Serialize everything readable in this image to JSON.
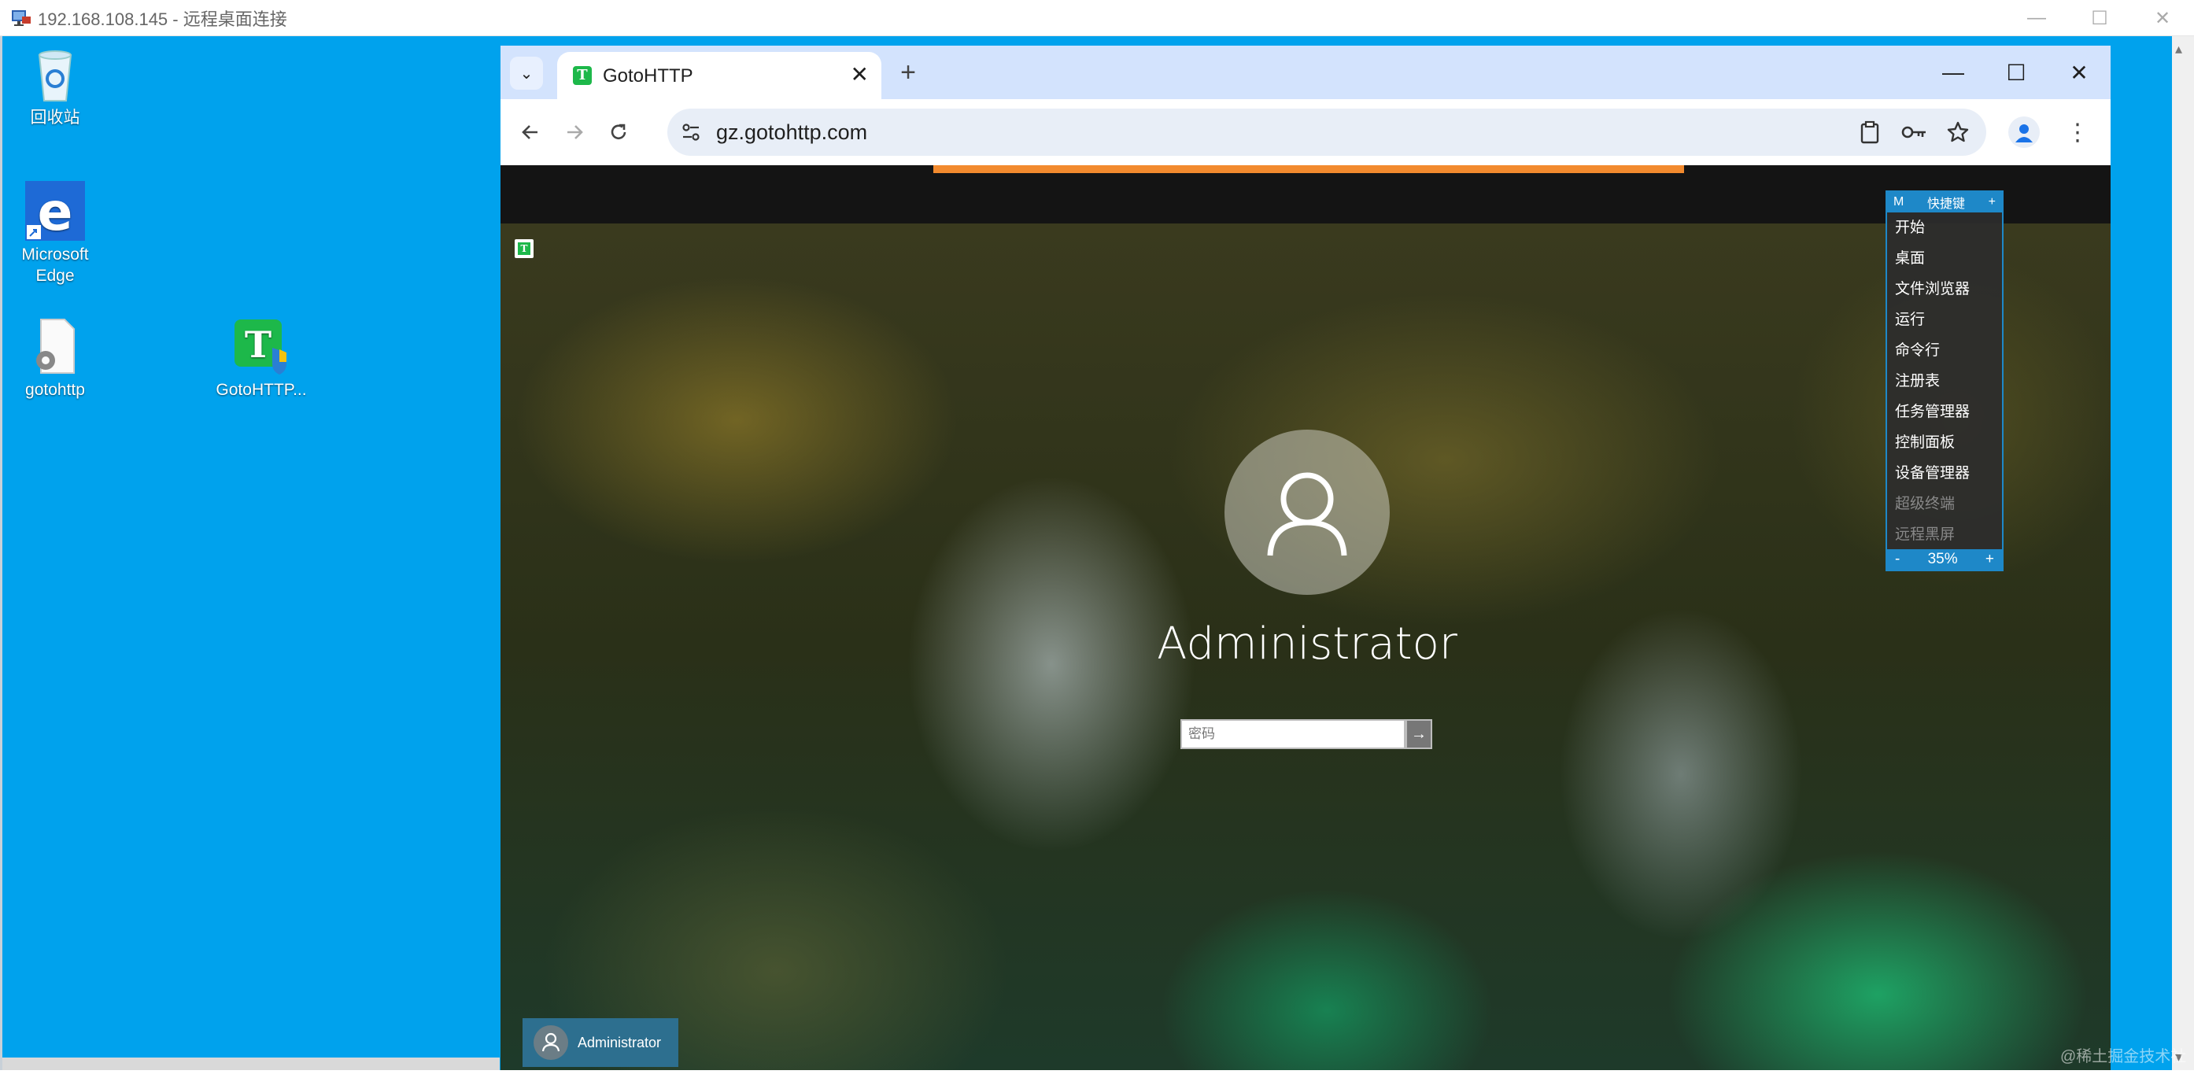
{
  "rdp": {
    "title": "192.168.108.145 - 远程桌面连接",
    "minimize": "—",
    "restore": "☐",
    "close": "✕"
  },
  "desktop": {
    "icons": [
      {
        "label": "回收站",
        "icon": "recycle-bin-icon"
      },
      {
        "label": "Microsoft Edge",
        "icon": "edge-icon"
      },
      {
        "label": "gotohttp",
        "icon": "settings-file-icon"
      },
      {
        "label": "GotoHTTP...",
        "icon": "gotohttp-app-icon"
      }
    ]
  },
  "browser": {
    "tab_title": "GotoHTTP",
    "tab_favicon": "T",
    "tab_close": "✕",
    "new_tab": "+",
    "url": "gz.gotohttp.com",
    "min": "—",
    "max": "☐",
    "close": "✕",
    "menu": "⋮"
  },
  "remote": {
    "badge": "T",
    "username": "Administrator",
    "password_placeholder": "密码",
    "submit": "→",
    "user_tile_name": "Administrator"
  },
  "shortcut_panel": {
    "mode": "M",
    "title": "快捷键",
    "head_plus": "+",
    "items": [
      "开始",
      "桌面",
      "文件浏览器",
      "运行",
      "命令行",
      "注册表",
      "任务管理器",
      "控制面板",
      "设备管理器",
      "超级终端",
      "远程黑屏"
    ],
    "zoom_minus": "-",
    "zoom": "35%",
    "zoom_plus": "+"
  },
  "watermark": "@稀土掘金技术社区",
  "colors": {
    "desktop": "#00a2ed",
    "tabstrip": "#d3e3fd",
    "accent_orange": "#f28a2e",
    "panel_blue": "#1e88c8"
  }
}
